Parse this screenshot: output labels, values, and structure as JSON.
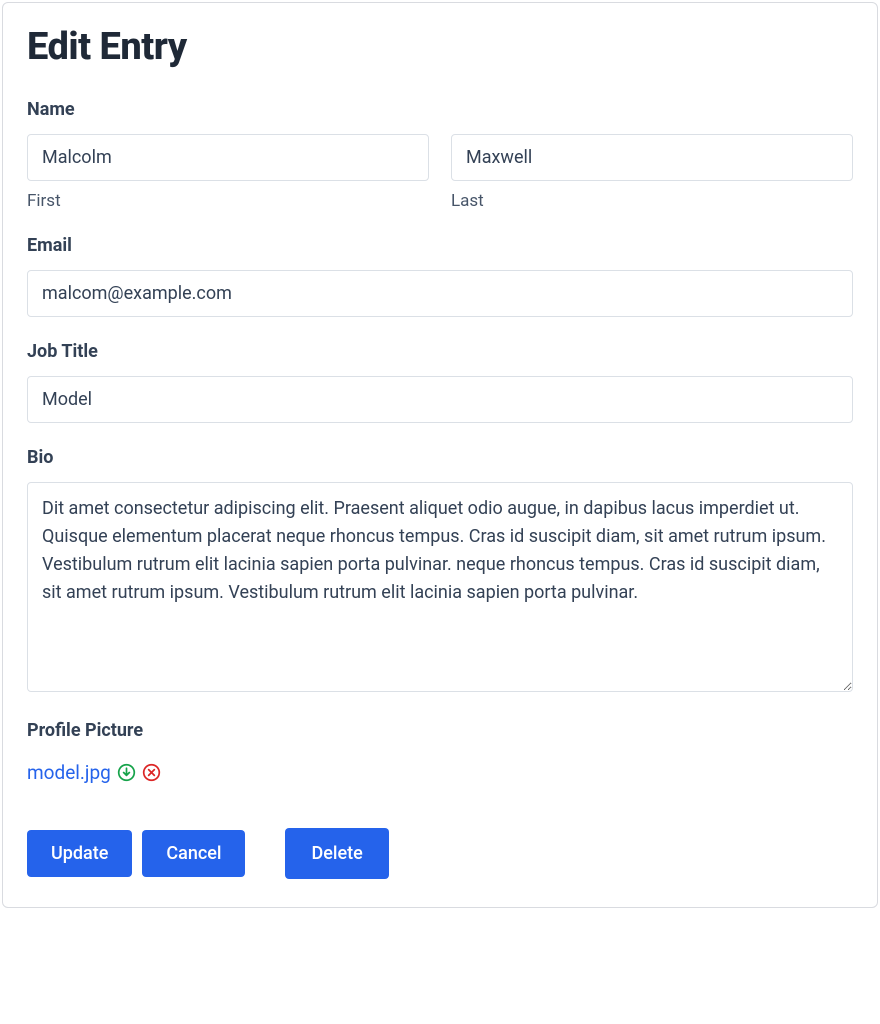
{
  "page": {
    "title": "Edit Entry"
  },
  "fields": {
    "name": {
      "label": "Name",
      "first": {
        "value": "Malcolm",
        "sublabel": "First"
      },
      "last": {
        "value": "Maxwell",
        "sublabel": "Last"
      }
    },
    "email": {
      "label": "Email",
      "value": "malcom@example.com"
    },
    "job_title": {
      "label": "Job Title",
      "value": "Model"
    },
    "bio": {
      "label": "Bio",
      "value": "Dit amet consectetur adipiscing elit. Praesent aliquet odio augue, in dapibus lacus imperdiet ut. Quisque elementum placerat neque rhoncus tempus. Cras id suscipit diam, sit amet rutrum ipsum. Vestibulum rutrum elit lacinia sapien porta pulvinar. neque rhoncus tempus. Cras id suscipit diam, sit amet rutrum ipsum. Vestibulum rutrum elit lacinia sapien porta pulvinar."
    },
    "profile_picture": {
      "label": "Profile Picture",
      "filename": "model.jpg"
    }
  },
  "buttons": {
    "update": "Update",
    "cancel": "Cancel",
    "delete": "Delete"
  }
}
